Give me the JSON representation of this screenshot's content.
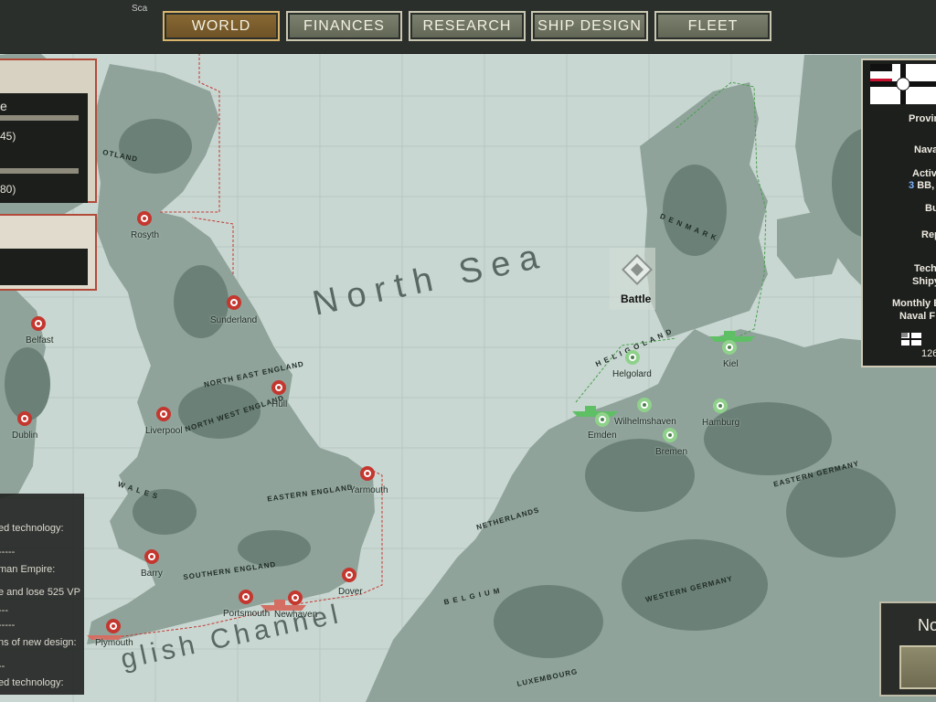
{
  "nav": {
    "world": "WORLD",
    "finances": "FINANCES",
    "research": "RESEARCH",
    "ship_design": "SHIP DESIGN",
    "fleet": "FLEET"
  },
  "top_cropped_city": "Sca",
  "left_panel_top": {
    "heading_fragment": "e",
    "value1_fragment": "45)",
    "value2_fragment": "80)"
  },
  "log_panel": {
    "lines": [
      "ed technology:",
      "-----",
      "man Empire:",
      "e and lose 525 VP",
      "---",
      "-----",
      "ns of new design:",
      "--",
      "ed technology:"
    ]
  },
  "right_panel": {
    "provin": "Provin",
    "nava": "Nava",
    "activ": "Activ",
    "bb_count": "3",
    "bb": "BB,",
    "bu": "Bu",
    "rep": "Rep",
    "tech": "Tech",
    "shipy": "Shipy",
    "monthly": "Monthly E",
    "naval_f": "Naval F",
    "num": "126"
  },
  "bottom_right_fragment": "No",
  "sea_labels": {
    "north_sea": "North Sea",
    "english_channel": "glish Channel"
  },
  "battle": {
    "label": "Battle"
  },
  "regions": {
    "otland": "OTLAND",
    "north_east_england": "NORTH EAST ENGLAND",
    "north_west_england": "NORTH WEST ENGLAND",
    "wales": "W A L E S",
    "eastern_england": "EASTERN ENGLAND",
    "southern_england": "SOUTHERN ENGLAND",
    "heligoland": "H E L I G O L A N D",
    "denmark": "D E N M A R K",
    "netherlands": "NETHERLANDS",
    "belgium": "B E L G I U M",
    "luxembourg": "LUXEMBOURG",
    "western_germany": "WESTERN GERMANY",
    "eastern_germany": "EASTERN GERMANY"
  },
  "cities": {
    "rosyth": "Rosyth",
    "sunderland": "Sunderland",
    "belfast": "Belfast",
    "hull": "Hull",
    "liverpool": "Liverpool",
    "dublin": "Dublin",
    "yarmouth": "Yarmouth",
    "barry": "Barry",
    "dover": "Dover",
    "portsmouth": "Portsmouth",
    "newhaven": "Newhaven",
    "plymouth": "Plymouth",
    "helgolard": "Helgolard",
    "kiel": "Kiel",
    "wilhelmshaven": "Wilhelmshaven",
    "emden": "Emden",
    "hamburg": "Hamburg",
    "bremen": "Bremen"
  },
  "colors": {
    "sea": "#c9d7d2",
    "land": "#8fa39a",
    "land_dark": "#5f746b",
    "uk_marker": "#c4372f",
    "german_marker": "#8fd18b",
    "active_tab": "#8a6a34"
  }
}
